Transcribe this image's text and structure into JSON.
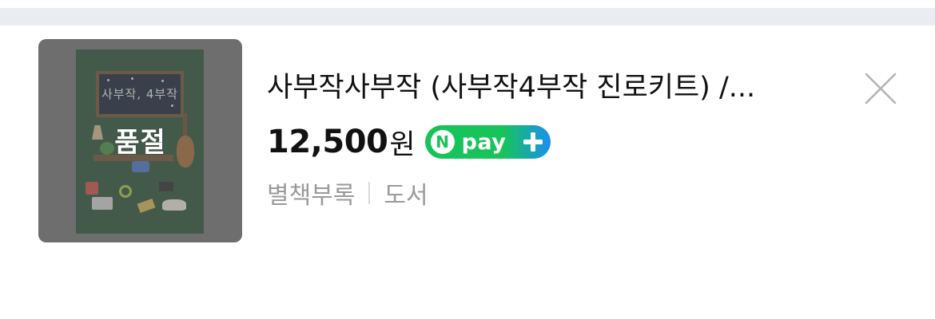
{
  "product": {
    "image_overlay_label": "품절",
    "cover_board_text": "사부작, 4부작",
    "title": "사부작사부작 (사부작4부작 진로키트) /...",
    "price": "12,500",
    "currency": "원",
    "npay": {
      "n_letter": "N",
      "label": "pay",
      "colors": {
        "green": "#17c45a",
        "blue": "#1a8ff0"
      }
    },
    "seller": "별책부록",
    "category": "도서"
  },
  "icons": {
    "close": "close-icon",
    "plus": "plus-icon"
  },
  "colors": {
    "top_strip": "#e9ecf0",
    "thumb_overlay": "#6e6e6e",
    "meta_text": "#9a9a9a"
  }
}
